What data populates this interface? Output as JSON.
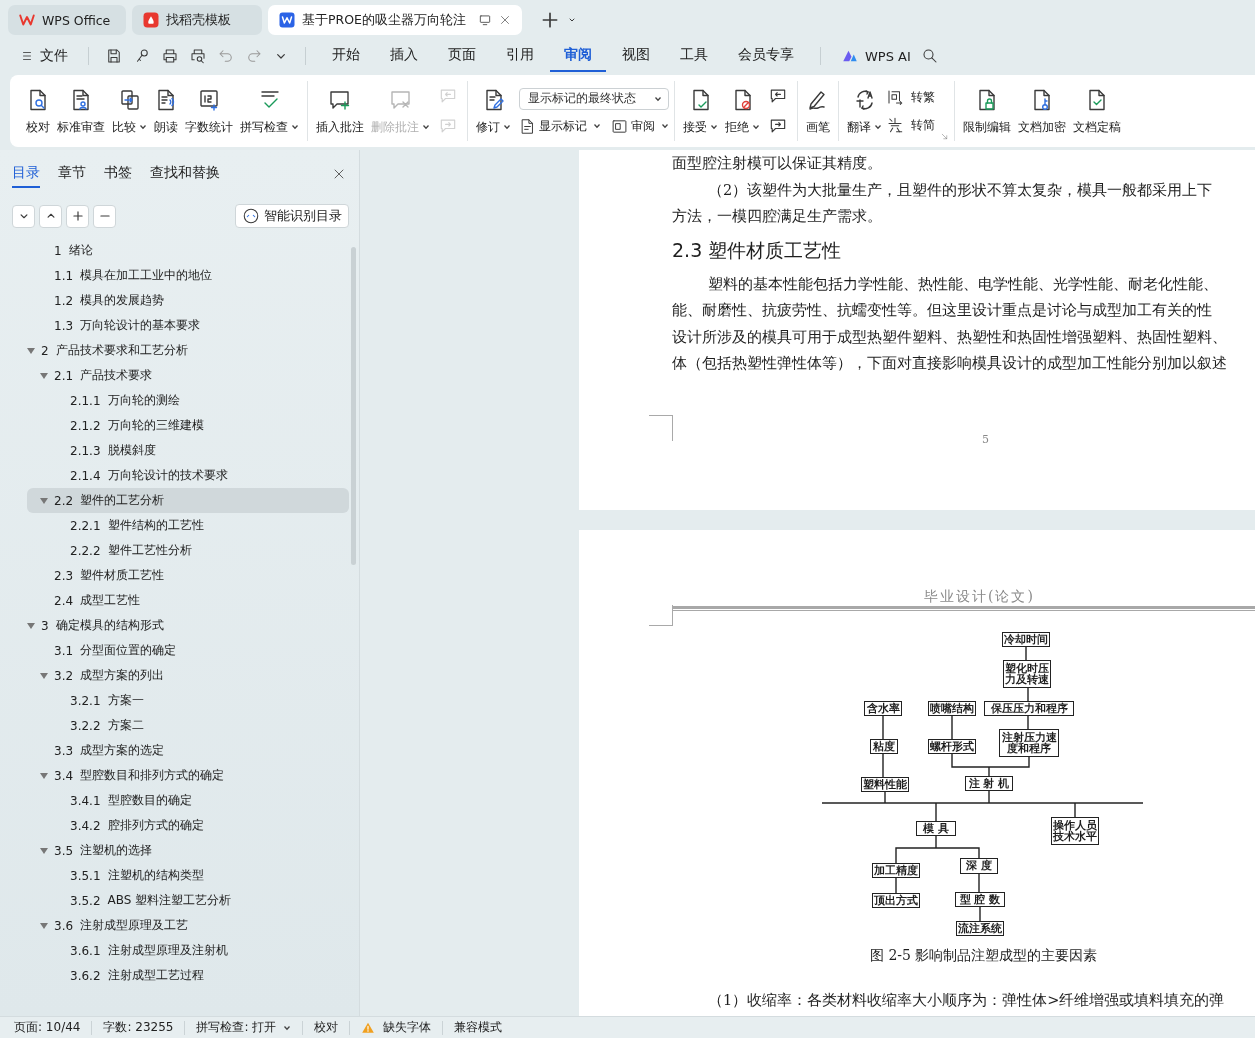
{
  "title_bar": {
    "tabs": [
      {
        "label": "WPS Office",
        "kind": "home",
        "selected": false
      },
      {
        "label": "找稻壳模板",
        "kind": "template",
        "selected": false
      },
      {
        "label": "基于PROE的吸尘器万向轮注",
        "kind": "document",
        "selected": true
      }
    ]
  },
  "menu_bar": {
    "file": "文件",
    "tabs": [
      {
        "label": "开始",
        "selected": false
      },
      {
        "label": "插入",
        "selected": false
      },
      {
        "label": "页面",
        "selected": false
      },
      {
        "label": "引用",
        "selected": false
      },
      {
        "label": "审阅",
        "selected": true
      },
      {
        "label": "视图",
        "selected": false
      },
      {
        "label": "工具",
        "selected": false
      },
      {
        "label": "会员专享",
        "selected": false
      }
    ],
    "ai": "WPS AI"
  },
  "ribbon": {
    "groups": [
      [
        {
          "kind": "large",
          "label": "校对",
          "dropdown": false,
          "disabled": false
        },
        {
          "kind": "large",
          "label": "标准审查",
          "dropdown": false,
          "disabled": false
        },
        {
          "kind": "large",
          "label": "比较",
          "dropdown": true,
          "disabled": false
        },
        {
          "kind": "large",
          "label": "朗读",
          "dropdown": false,
          "disabled": false
        },
        {
          "kind": "large",
          "label": "字数统计",
          "dropdown": false,
          "disabled": false
        },
        {
          "kind": "large",
          "label": "拼写检查",
          "dropdown": true,
          "disabled": false
        }
      ],
      [
        {
          "kind": "large",
          "label": "插入批注",
          "dropdown": false,
          "disabled": false
        },
        {
          "kind": "large",
          "label": "删除批注",
          "dropdown": true,
          "disabled": true
        },
        {
          "kind": "icon-pair",
          "disabled": true
        }
      ],
      [
        {
          "kind": "large",
          "label": "修订",
          "dropdown": true,
          "disabled": false
        },
        {
          "kind": "panel",
          "select": "显示标记的最终状态",
          "buttons": [
            {
              "label": "显示标记",
              "dropdown": true
            },
            {
              "label": "审阅",
              "dropdown": true
            }
          ]
        }
      ],
      [
        {
          "kind": "large",
          "label": "接受",
          "dropdown": true,
          "disabled": false
        },
        {
          "kind": "large",
          "label": "拒绝",
          "dropdown": true,
          "disabled": false
        },
        {
          "kind": "icon-pair",
          "disabled": false
        }
      ],
      [
        {
          "kind": "large",
          "label": "画笔",
          "dropdown": false,
          "disabled": false
        }
      ],
      [
        {
          "kind": "large",
          "label": "翻译",
          "dropdown": true,
          "disabled": false
        },
        {
          "kind": "small-stack",
          "buttons": [
            {
              "label": "转繁"
            },
            {
              "label": "转简"
            }
          ]
        }
      ],
      [
        {
          "kind": "large",
          "label": "限制编辑",
          "dropdown": false,
          "disabled": false
        },
        {
          "kind": "large",
          "label": "文档加密",
          "dropdown": false,
          "disabled": false
        },
        {
          "kind": "large",
          "label": "文档定稿",
          "dropdown": false,
          "disabled": false
        }
      ]
    ]
  },
  "sidebar": {
    "tabs": [
      {
        "label": "目录",
        "selected": true
      },
      {
        "label": "章节",
        "selected": false
      },
      {
        "label": "书签",
        "selected": false
      },
      {
        "label": "查找和替换",
        "selected": false
      }
    ],
    "tool_button": "智能识别目录",
    "toc": [
      {
        "number": "1",
        "title": "绪论",
        "selected": false
      },
      {
        "number": "1.1",
        "title": "模具在加工工业中的地位",
        "selected": false
      },
      {
        "number": "1.2",
        "title": "模具的发展趋势",
        "selected": false
      },
      {
        "number": "1.3",
        "title": "万向轮设计的基本要求",
        "selected": false
      },
      {
        "number": "2",
        "title": "产品技术要求和工艺分析",
        "selected": false,
        "expanded": true,
        "children": [
          {
            "number": "2.1",
            "title": "产品技术要求",
            "selected": false,
            "expanded": true,
            "children": [
              {
                "number": "2.1.1",
                "title": "万向轮的测绘",
                "selected": false
              },
              {
                "number": "2.1.2",
                "title": "万向轮的三维建模",
                "selected": false
              },
              {
                "number": "2.1.3",
                "title": "脱模斜度",
                "selected": false
              },
              {
                "number": "2.1.4",
                "title": "万向轮设计的技术要求",
                "selected": false
              }
            ]
          },
          {
            "number": "2.2",
            "title": "塑件的工艺分析",
            "selected": true,
            "expanded": true,
            "children": [
              {
                "number": "2.2.1",
                "title": "塑件结构的工艺性",
                "selected": false
              },
              {
                "number": "2.2.2",
                "title": "塑件工艺性分析",
                "selected": false
              }
            ]
          },
          {
            "number": "2.3",
            "title": "塑件材质工艺性",
            "selected": false
          },
          {
            "number": "2.4",
            "title": "成型工艺性",
            "selected": false
          }
        ]
      },
      {
        "number": "3",
        "title": "确定模具的结构形式",
        "selected": false,
        "expanded": true,
        "children": [
          {
            "number": "3.1",
            "title": "分型面位置的确定",
            "selected": false
          },
          {
            "number": "3.2",
            "title": "成型方案的列出",
            "selected": false,
            "expanded": true,
            "children": [
              {
                "number": "3.2.1",
                "title": "方案一",
                "selected": false
              },
              {
                "number": "3.2.2",
                "title": "方案二",
                "selected": false
              }
            ]
          },
          {
            "number": "3.3",
            "title": "成型方案的选定",
            "selected": false
          },
          {
            "number": "3.4",
            "title": "型腔数目和排列方式的确定",
            "selected": false,
            "expanded": true,
            "children": [
              {
                "number": "3.4.1",
                "title": "型腔数目的确定",
                "selected": false
              },
              {
                "number": "3.4.2",
                "title": "腔排列方式的确定",
                "selected": false
              }
            ]
          },
          {
            "number": "3.5",
            "title": "注塑机的选择",
            "selected": false,
            "expanded": true,
            "children": [
              {
                "number": "3.5.1",
                "title": "注塑机的结构类型",
                "selected": false
              },
              {
                "number": "3.5.2",
                "title": "ABS 塑料注塑工艺分析",
                "selected": false
              }
            ]
          },
          {
            "number": "3.6",
            "title": "注射成型原理及工艺",
            "selected": false,
            "expanded": true,
            "children": [
              {
                "number": "3.6.1",
                "title": "注射成型原理及注射机",
                "selected": false
              },
              {
                "number": "3.6.2",
                "title": "注射成型工艺过程",
                "selected": false
              }
            ]
          }
        ]
      }
    ]
  },
  "document": {
    "page_1": {
      "lines": [
        {
          "kind": "cont",
          "text": "面型腔注射模可以保证其精度。"
        },
        {
          "kind": "first",
          "text": "（2）该塑件为大批量生产，且塑件的形状不算太复杂，模具一般都采用上下"
        },
        {
          "kind": "cont",
          "text": "方法，一模四腔满足生产需求。"
        },
        {
          "kind": "heading",
          "text": "2.3 塑件材质工艺性"
        },
        {
          "kind": "first",
          "text": "塑料的基本性能包括力学性能、热性能、电学性能、光学性能、耐老化性能、"
        },
        {
          "kind": "cont",
          "text": "能、耐磨性、抗疲劳性、抗蠕变性等。但这里设计重点是讨论与成型加工有关的性"
        },
        {
          "kind": "cont",
          "text": "设计所涉及的模具可用于成型热塑件塑料、热塑性和热固性增强塑料、热固性塑料、"
        },
        {
          "kind": "cont",
          "text": "体（包括热塑性弹性体等），下面对直接影响模具设计的成型加工性能分别加以叙述"
        }
      ],
      "page_number": "5"
    },
    "page_2": {
      "header": "毕业设计(论文)",
      "diagram": {
        "nodes": [
          "冷却时间",
          "塑化时压力及转速",
          "含水率",
          "喷嘴结构",
          "保压压力和程序",
          "粘度",
          "螺杆形式",
          "注射压力速度和程序",
          "塑料性能",
          "注 射 机",
          "模 具",
          "操作人员技术水平",
          "加工精度",
          "深 度",
          "顶出方式",
          "型 腔 数",
          "流注系统"
        ]
      },
      "caption": "图 2-5 影响制品注塑成型的主要因素",
      "lines": [
        {
          "kind": "first",
          "text": "（1）收缩率：各类材料收缩率大小顺序为：弹性体>纤维增强或填料填充的弹"
        }
      ]
    }
  },
  "status_bar": [
    {
      "kind": "plain",
      "label": "页面: 10/44"
    },
    {
      "kind": "plain",
      "label": "字数: 23255"
    },
    {
      "kind": "dropdown",
      "label": "拼写检查: 打开"
    },
    {
      "kind": "plain",
      "label": "校对"
    },
    {
      "kind": "warning",
      "label": "缺失字体"
    },
    {
      "kind": "plain",
      "label": "兼容模式"
    }
  ]
}
